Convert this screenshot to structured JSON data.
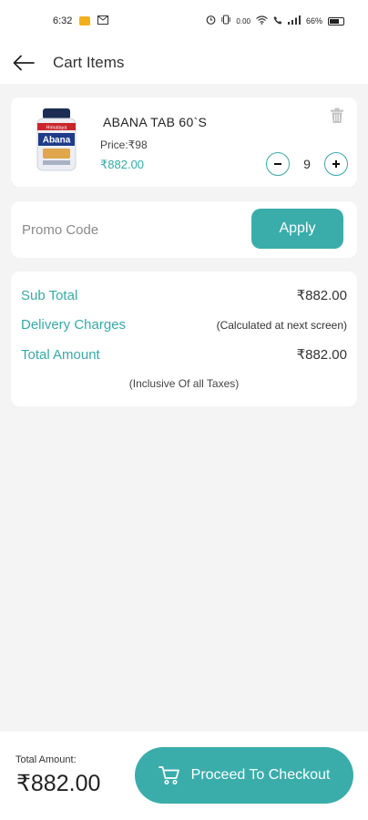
{
  "status_bar": {
    "time": "6:32",
    "network_speed": "0.00",
    "battery": "66%"
  },
  "header": {
    "title": "Cart Items"
  },
  "cart_items": [
    {
      "name": "ABANA TAB 60`S",
      "price": "Price:₹98",
      "total": "₹882.00",
      "quantity": "9",
      "image_brand": "Himalaya",
      "image_label": "Abana"
    }
  ],
  "promo": {
    "placeholder": "Promo Code",
    "apply_label": "Apply"
  },
  "summary": {
    "sub_total_label": "Sub Total",
    "sub_total_value": "₹882.00",
    "delivery_label": "Delivery Charges",
    "delivery_value": "(Calculated at next screen)",
    "total_label": "Total Amount",
    "total_value": "₹882.00",
    "tax_note": "(Inclusive Of all Taxes)"
  },
  "footer": {
    "total_caption": "Total Amount:",
    "total_amount": "₹882.00",
    "checkout_label": "Proceed To Checkout"
  },
  "colors": {
    "accent": "#3aadab",
    "background": "#f4f4f4"
  }
}
